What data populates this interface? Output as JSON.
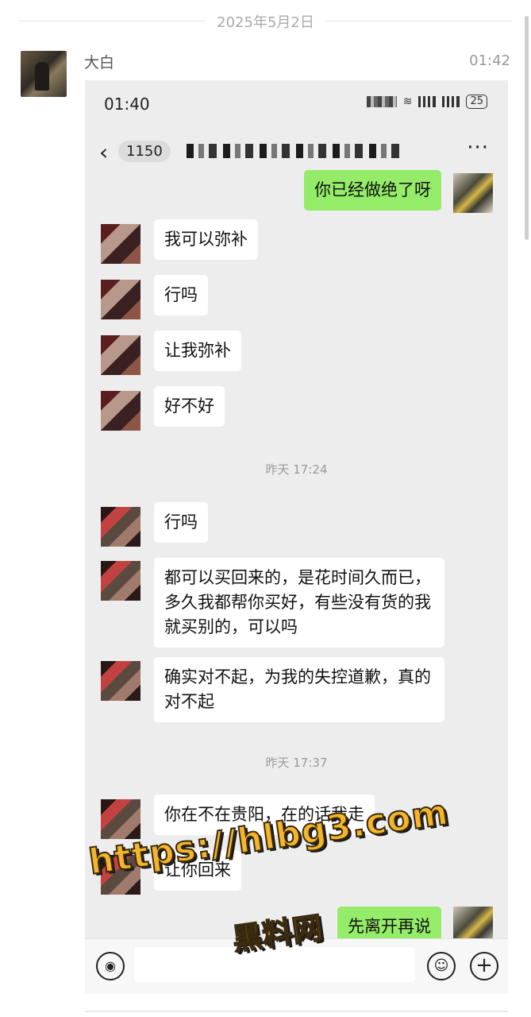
{
  "date_separator": "2025年5月2日",
  "sender_name": "大白",
  "message_time": "01:42",
  "screenshot": {
    "status_time": "01:40",
    "battery": "25",
    "unread_count": "1150",
    "more_icon": "···",
    "back_icon": "‹",
    "messages": [
      {
        "side": "right",
        "text": "你已经做绝了呀"
      },
      {
        "side": "left",
        "text": "我可以弥补"
      },
      {
        "side": "left",
        "text": "行吗"
      },
      {
        "side": "left",
        "text": "让我弥补"
      },
      {
        "side": "left",
        "text": "好不好"
      },
      {
        "side": "left",
        "text": "行吗"
      },
      {
        "side": "left",
        "text": "都可以买回来的，是花时间久而已，多久我都帮你买好，有些没有货的我就买别的，可以吗"
      },
      {
        "side": "left",
        "text": "确实对不起，为我的失控道歉，真的对不起"
      },
      {
        "side": "left",
        "text": "你在不在贵阳，在的话我走"
      },
      {
        "side": "left",
        "text": "让你回来"
      },
      {
        "side": "right",
        "text": "先离开再说"
      }
    ],
    "timestamps": [
      "昨天 17:24",
      "昨天 17:37"
    ]
  },
  "watermark": {
    "url": "https://hlbg3.com",
    "text": "黑料网"
  },
  "icons": [
    "back-icon",
    "more-icon",
    "voice-icon",
    "emoji-icon",
    "plus-icon"
  ]
}
